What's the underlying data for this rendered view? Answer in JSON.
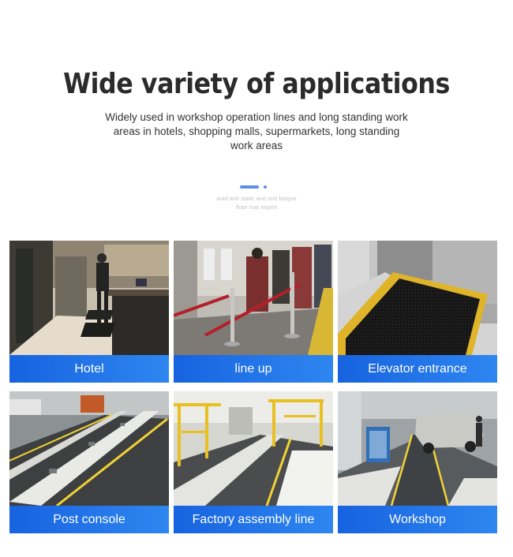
{
  "heading": "Wide variety of applications",
  "description": "Widely used in workshop operation lines and long standing work areas in hotels, shopping malls, supermarkets, long standing work areas",
  "watermark": "Asid anti static and anti fatigue floor mat expert",
  "applications": [
    {
      "label": "Hotel"
    },
    {
      "label": "line up"
    },
    {
      "label": "Elevator entrance"
    },
    {
      "label": "Post console"
    },
    {
      "label": "Factory assembly line"
    },
    {
      "label": "Workshop"
    }
  ],
  "colors": {
    "caption_start": "#1763e0",
    "caption_end": "#2e86f0",
    "accent": "#5b8fe8"
  }
}
